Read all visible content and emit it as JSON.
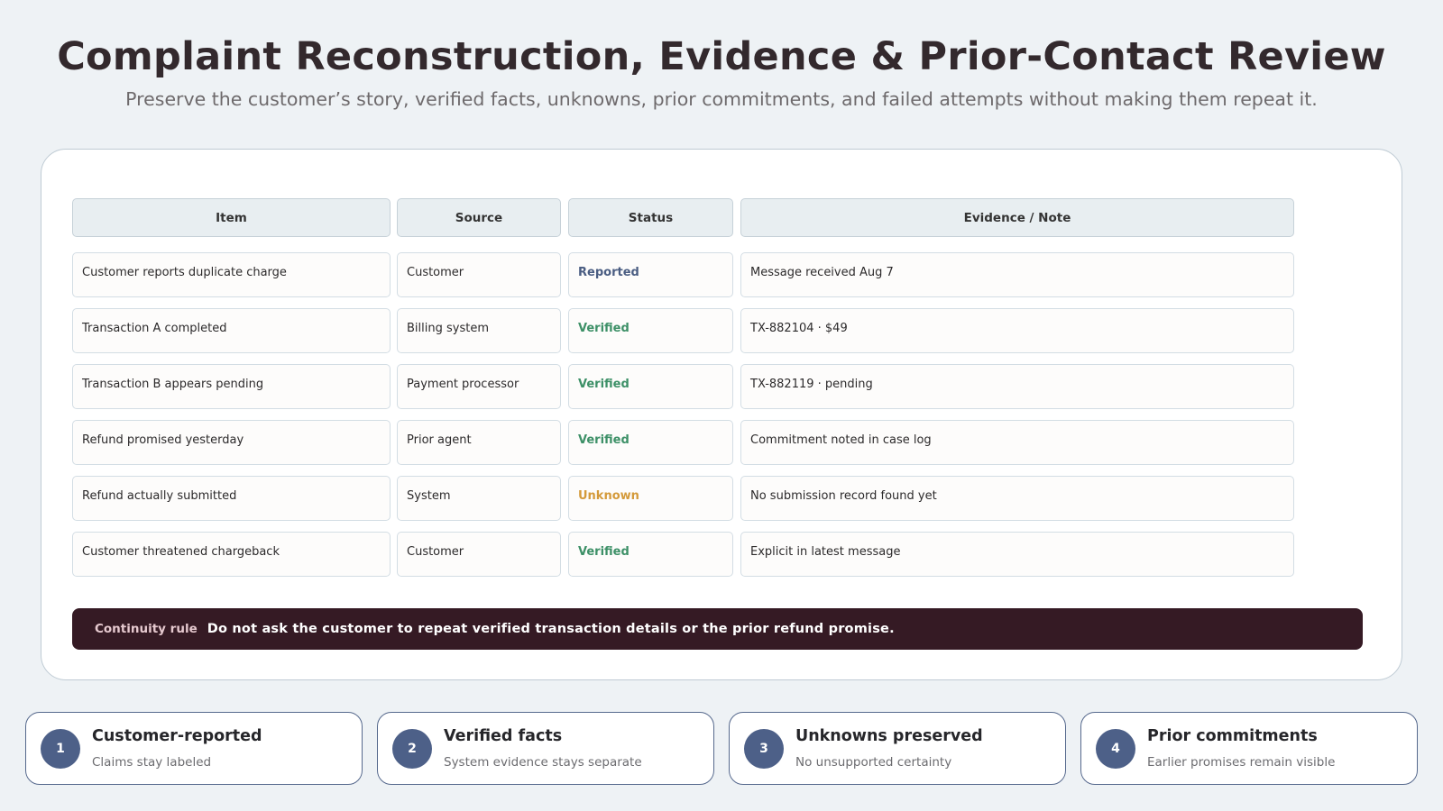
{
  "header": {
    "title": "Complaint Reconstruction, Evidence & Prior-Contact Review",
    "subtitle": "Preserve the customer’s story, verified facts, unknowns, prior commitments, and failed attempts without making them repeat it."
  },
  "table": {
    "columns": [
      "Item",
      "Source",
      "Status",
      "Evidence / Note"
    ],
    "rows": [
      {
        "item": "Customer reports duplicate charge",
        "source": "Customer",
        "status": "Reported",
        "note": "Message received Aug 7"
      },
      {
        "item": "Transaction A completed",
        "source": "Billing system",
        "status": "Verified",
        "note": "TX-882104 · $49"
      },
      {
        "item": "Transaction B appears pending",
        "source": "Payment processor",
        "status": "Verified",
        "note": "TX-882119 · pending"
      },
      {
        "item": "Refund promised yesterday",
        "source": "Prior agent",
        "status": "Verified",
        "note": "Commitment noted in case log"
      },
      {
        "item": "Refund actually submitted",
        "source": "System",
        "status": "Unknown",
        "note": "No submission record found yet"
      },
      {
        "item": "Customer threatened chargeback",
        "source": "Customer",
        "status": "Verified",
        "note": "Explicit in latest message"
      }
    ]
  },
  "continuity_rule": {
    "label": "Continuity rule",
    "text": "Do not ask the customer to repeat verified transaction details or the prior refund promise."
  },
  "cards": [
    {
      "number": "1",
      "title": "Customer-reported",
      "desc": "Claims stay labeled"
    },
    {
      "number": "2",
      "title": "Verified facts",
      "desc": "System evidence stays separate"
    },
    {
      "number": "3",
      "title": "Unknowns preserved",
      "desc": "No unsupported certainty"
    },
    {
      "number": "4",
      "title": "Prior commitments",
      "desc": "Earlier promises remain visible"
    }
  ],
  "colors": {
    "reported": "#4a5d82",
    "verified": "#3d9067",
    "unknown": "#d49a3a",
    "rule_bg": "#351a24",
    "badge": "#4d6088"
  }
}
